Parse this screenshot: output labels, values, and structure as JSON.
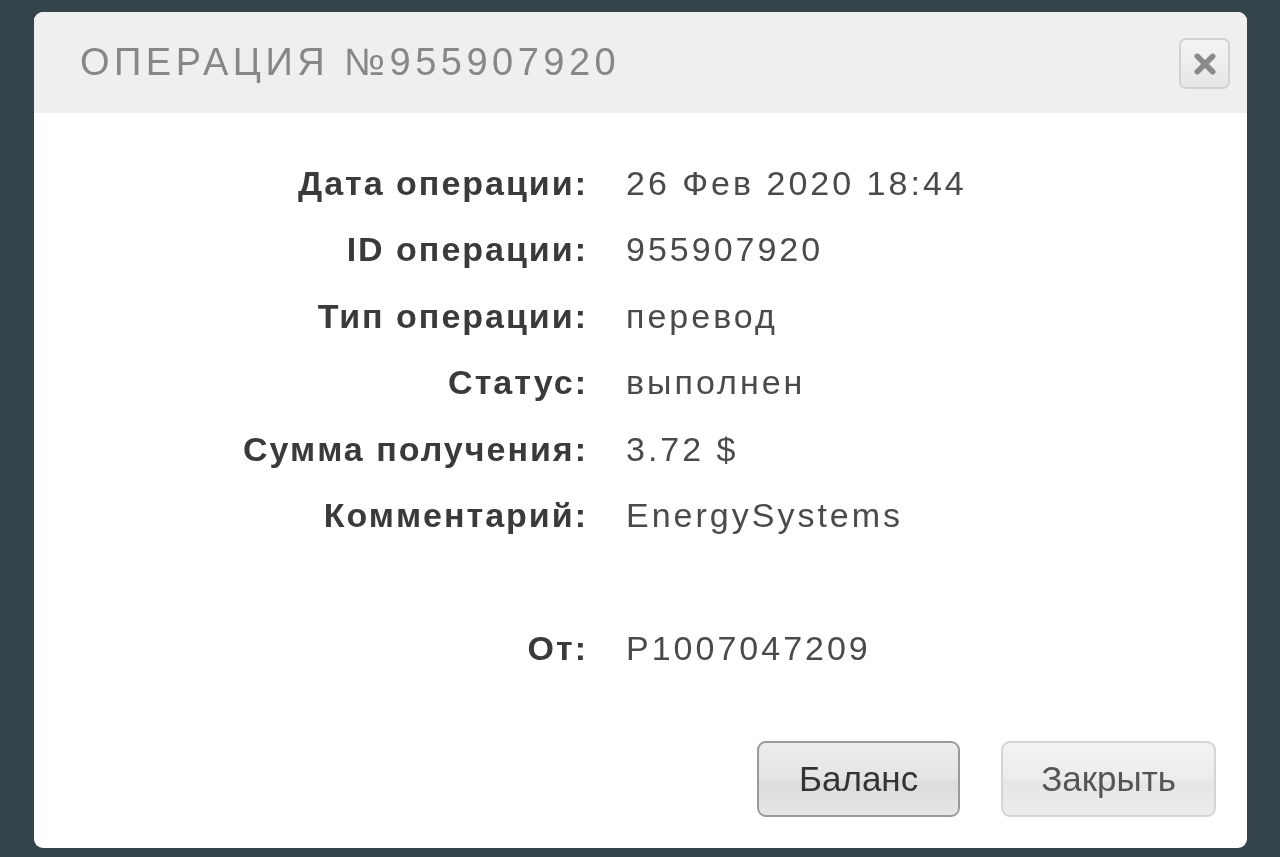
{
  "dialog": {
    "title": "ОПЕРАЦИЯ №955907920"
  },
  "sections": [
    {
      "rows": [
        {
          "label": "Дата операции:",
          "value": "26 Фев 2020 18:44"
        },
        {
          "label": "ID операции:",
          "value": "955907920"
        },
        {
          "label": "Тип операции:",
          "value": "перевод"
        },
        {
          "label": "Статус:",
          "value": "выполнен"
        },
        {
          "label": "Сумма получения:",
          "value": "3.72 $"
        },
        {
          "label": "Комментарий:",
          "value": "EnergySystems"
        }
      ]
    },
    {
      "rows": [
        {
          "label": "От:",
          "value": "P1007047209"
        }
      ]
    }
  ],
  "buttons": [
    {
      "label": "Баланс",
      "focused": true
    },
    {
      "label": "Закрыть",
      "focused": false
    }
  ]
}
